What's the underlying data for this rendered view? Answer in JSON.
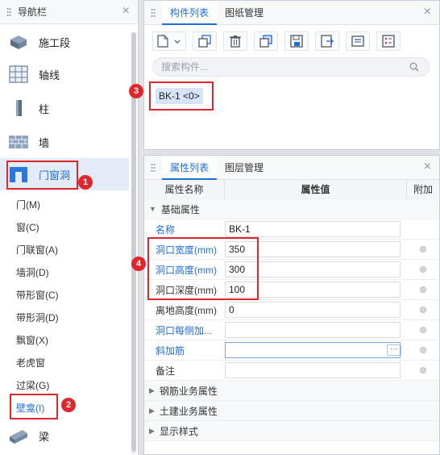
{
  "nav": {
    "title": "导航栏",
    "categories": [
      {
        "label": "施工段",
        "icon": "stage-icon"
      },
      {
        "label": "轴线",
        "icon": "grid-icon"
      },
      {
        "label": "柱",
        "icon": "column-icon"
      },
      {
        "label": "墙",
        "icon": "wall-icon"
      },
      {
        "label": "门窗洞",
        "icon": "door-window-icon"
      },
      {
        "label": "梁",
        "icon": "beam-icon"
      }
    ],
    "subitems": [
      "门(M)",
      "窗(C)",
      "门联窗(A)",
      "墙洞(D)",
      "带形窗(C)",
      "带形洞(D)",
      "飘窗(X)",
      "老虎窗",
      "过梁(G)",
      "壁龛(I)"
    ],
    "selected_subitem": "壁龛(I)"
  },
  "components_panel": {
    "tabs": [
      "构件列表",
      "图纸管理"
    ],
    "active_tab": "构件列表",
    "search_placeholder": "搜索构件...",
    "items": [
      "BK-1 <0>"
    ]
  },
  "properties_panel": {
    "tabs": [
      "属性列表",
      "图层管理"
    ],
    "active_tab": "属性列表",
    "headers": {
      "name": "属性名称",
      "value": "属性值",
      "extra": "附加"
    },
    "groups": {
      "basic": "基础属性",
      "rebar": "钢筋业务属性",
      "civil": "土建业务属性",
      "display": "显示样式"
    },
    "rows": [
      {
        "name": "名称",
        "value": "BK-1"
      },
      {
        "name": "洞口宽度(mm)",
        "value": "350"
      },
      {
        "name": "洞口高度(mm)",
        "value": "300"
      },
      {
        "name": "洞口深度(mm)",
        "value": "100"
      },
      {
        "name": "离地高度(mm)",
        "value": "0"
      },
      {
        "name": "洞口每侧加...",
        "value": ""
      },
      {
        "name": "斜加筋",
        "value": "",
        "button": "···"
      },
      {
        "name": "备注",
        "value": ""
      }
    ]
  },
  "annotations": [
    "1",
    "2",
    "3",
    "4"
  ],
  "colors": {
    "accent": "#1f6dd8",
    "highlight": "#e0272d"
  }
}
